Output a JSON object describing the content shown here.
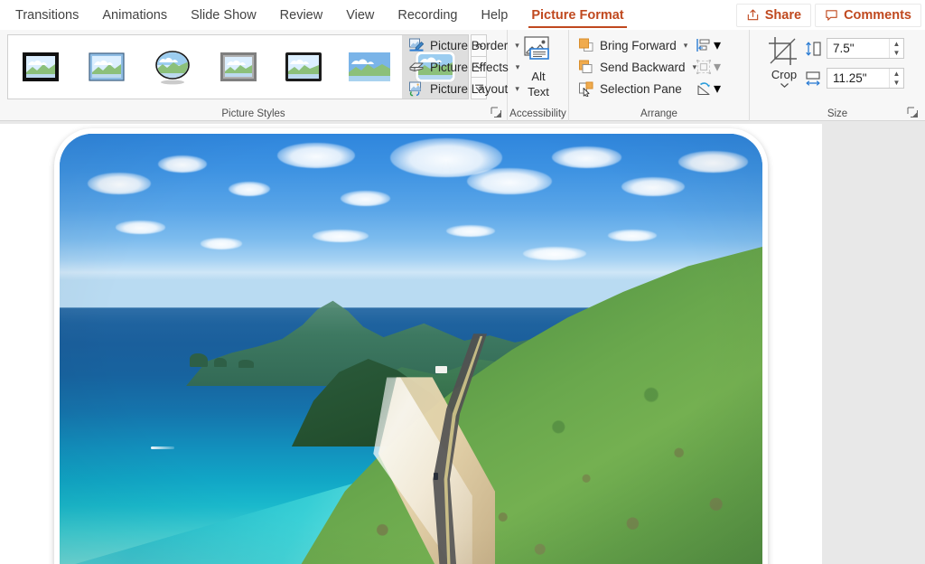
{
  "tabs": [
    {
      "label": "Transitions",
      "active": false
    },
    {
      "label": "Animations",
      "active": false
    },
    {
      "label": "Slide Show",
      "active": false
    },
    {
      "label": "Review",
      "active": false
    },
    {
      "label": "View",
      "active": false
    },
    {
      "label": "Recording",
      "active": false
    },
    {
      "label": "Help",
      "active": false
    },
    {
      "label": "Picture Format",
      "active": true
    }
  ],
  "tabbar_right": {
    "share_label": "Share",
    "share_icon": "share-icon",
    "comments_label": "Comments",
    "comments_icon": "comment-bubble-icon"
  },
  "ribbon": {
    "picture_styles": {
      "group_label": "Picture Styles",
      "dialog_launcher_icon": "dialog-launcher-icon",
      "thumbnails": [
        {
          "name": "simple-frame-black",
          "selected": false
        },
        {
          "name": "beveled-matte-white",
          "selected": false
        },
        {
          "name": "metal-oval",
          "selected": false
        },
        {
          "name": "drop-shadow-rectangle",
          "selected": false
        },
        {
          "name": "reflected-rounded-rectangle",
          "selected": false
        },
        {
          "name": "soft-edge-rectangle",
          "selected": false
        },
        {
          "name": "rounded-diagonal-corner-white",
          "selected": true
        }
      ],
      "scroll_up_icon": "chevron-up-icon",
      "scroll_down_icon": "chevron-down-icon",
      "more_icon": "more-styles-icon",
      "commands": [
        {
          "label": "Picture Border",
          "icon": "pencil-border-icon",
          "has_chevron": true
        },
        {
          "label": "Picture Effects",
          "icon": "picture-effects-icon",
          "has_chevron": true
        },
        {
          "label": "Picture Layout",
          "icon": "picture-layout-icon",
          "has_chevron": true
        }
      ]
    },
    "accessibility": {
      "group_label": "Accessibility",
      "alt_text_label_line1": "Alt",
      "alt_text_label_line2": "Text",
      "alt_text_icon": "alt-text-icon"
    },
    "arrange": {
      "group_label": "Arrange",
      "commands": [
        {
          "label": "Bring Forward",
          "icon": "bring-forward-icon",
          "has_chevron": true,
          "disabled": false
        },
        {
          "label": "Send Backward",
          "icon": "send-backward-icon",
          "has_chevron": true,
          "disabled": false
        },
        {
          "label": "Selection Pane",
          "icon": "selection-pane-icon",
          "has_chevron": false,
          "disabled": false
        }
      ],
      "mini_commands": [
        {
          "name": "align-objects",
          "icon": "align-icon",
          "has_chevron": true,
          "disabled": false
        },
        {
          "name": "group-objects",
          "icon": "group-icon",
          "has_chevron": true,
          "disabled": true
        },
        {
          "name": "rotate-objects",
          "icon": "rotate-icon",
          "has_chevron": true,
          "disabled": false
        }
      ]
    },
    "size": {
      "group_label": "Size",
      "crop_label": "Crop",
      "crop_icon": "crop-icon",
      "crop_chevron_icon": "chevron-down-icon",
      "height": {
        "icon": "shape-height-icon",
        "value": "7.5\"",
        "up_icon": "spinner-up-icon",
        "down_icon": "spinner-down-icon"
      },
      "width": {
        "icon": "shape-width-icon",
        "value": "11.25\"",
        "up_icon": "spinner-up-icon",
        "down_icon": "spinner-down-icon"
      },
      "dialog_launcher_icon": "dialog-launcher-icon"
    }
  },
  "slide": {
    "picture": {
      "name": "coastal-landscape-photo",
      "alt": "Aerial view of a tropical coastline with turquoise water, a winding coastal road and green mountains",
      "style": "Rounded Diagonal Corner, White"
    }
  },
  "colors": {
    "accent": "#c0491f",
    "ribbon_bg": "#f7f7f7",
    "tab_text": "#434343",
    "workspace_bg": "#e8e8e8",
    "slide_bg": "#ffffff",
    "orange_icon": "#ed9b3a",
    "blue_icon": "#2b7cd3"
  }
}
